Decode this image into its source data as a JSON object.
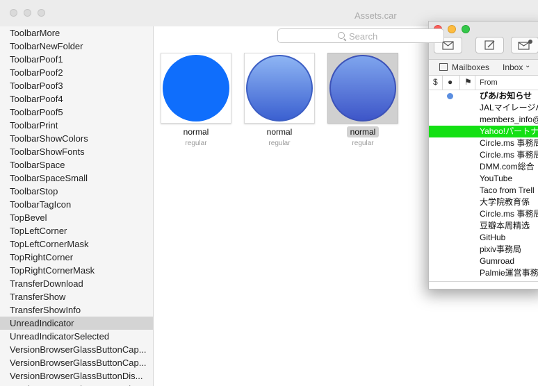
{
  "window": {
    "title": "Assets.car"
  },
  "search": {
    "placeholder": "Search"
  },
  "sidebar": {
    "items": [
      {
        "label": "ToolbarMore"
      },
      {
        "label": "ToolbarNewFolder"
      },
      {
        "label": "ToolbarPoof1"
      },
      {
        "label": "ToolbarPoof2"
      },
      {
        "label": "ToolbarPoof3"
      },
      {
        "label": "ToolbarPoof4"
      },
      {
        "label": "ToolbarPoof5"
      },
      {
        "label": "ToolbarPrint"
      },
      {
        "label": "ToolbarShowColors"
      },
      {
        "label": "ToolbarShowFonts"
      },
      {
        "label": "ToolbarSpace"
      },
      {
        "label": "ToolbarSpaceSmall"
      },
      {
        "label": "ToolbarStop"
      },
      {
        "label": "ToolbarTagIcon"
      },
      {
        "label": "TopBevel"
      },
      {
        "label": "TopLeftCorner"
      },
      {
        "label": "TopLeftCornerMask"
      },
      {
        "label": "TopRightCorner"
      },
      {
        "label": "TopRightCornerMask"
      },
      {
        "label": "TransferDownload"
      },
      {
        "label": "TransferShow"
      },
      {
        "label": "TransferShowInfo"
      },
      {
        "label": "UnreadIndicator",
        "selected": true
      },
      {
        "label": "UnreadIndicatorSelected"
      },
      {
        "label": "VersionBrowserGlassButtonCap..."
      },
      {
        "label": "VersionBrowserGlassButtonCap..."
      },
      {
        "label": "VersionBrowserGlassButtonDis..."
      },
      {
        "label": "VersionBrowserGlassButtonDis..."
      }
    ]
  },
  "assets": [
    {
      "label": "normal",
      "sublabel": "regular",
      "color": "#0f6efc",
      "style": "flat",
      "selected": false
    },
    {
      "label": "normal",
      "sublabel": "regular",
      "color": "#5d8ee8",
      "style": "gradient",
      "selected": false
    },
    {
      "label": "normal",
      "sublabel": "regular",
      "color": "#5a7ed8",
      "style": "gradient",
      "selected": true
    }
  ],
  "mail": {
    "toolbar": {
      "mailboxes_label": "Mailboxes",
      "inbox_label": "Inbox"
    },
    "columns": {
      "from_label": "From"
    },
    "messages": [
      {
        "from": "ぴあ/お知らせ",
        "unread": true,
        "bold": true
      },
      {
        "from": "JALマイレージバ",
        "unread": false
      },
      {
        "from": "members_info@",
        "unread": false
      },
      {
        "from": "Yahoo!パートナー",
        "unread": false,
        "highlighted": true
      },
      {
        "from": "Circle.ms 事務局",
        "unread": false
      },
      {
        "from": "Circle.ms 事務局",
        "unread": false
      },
      {
        "from": "DMM.com総合",
        "unread": false
      },
      {
        "from": "YouTube",
        "unread": false
      },
      {
        "from": "Taco from Trell",
        "unread": false
      },
      {
        "from": "大学院教育係",
        "unread": false
      },
      {
        "from": "Circle.ms 事務局",
        "unread": false
      },
      {
        "from": "豆瓣本周精选",
        "unread": false
      },
      {
        "from": "GitHub",
        "unread": false
      },
      {
        "from": "pixiv事務局",
        "unread": false
      },
      {
        "from": "Gumroad",
        "unread": false
      },
      {
        "from": "Palmie運営事務局",
        "unread": false
      }
    ]
  },
  "colors": {
    "highlight_green": "#14e014",
    "selection_gray": "#d4d4d4",
    "unread_dot": "#5b8ee0"
  },
  "icons": [
    "search-icon",
    "compose-icon",
    "mailbox-icon",
    "get-mail-icon",
    "new-message-icon",
    "chevron-down-icon",
    "sidebar-icon"
  ]
}
